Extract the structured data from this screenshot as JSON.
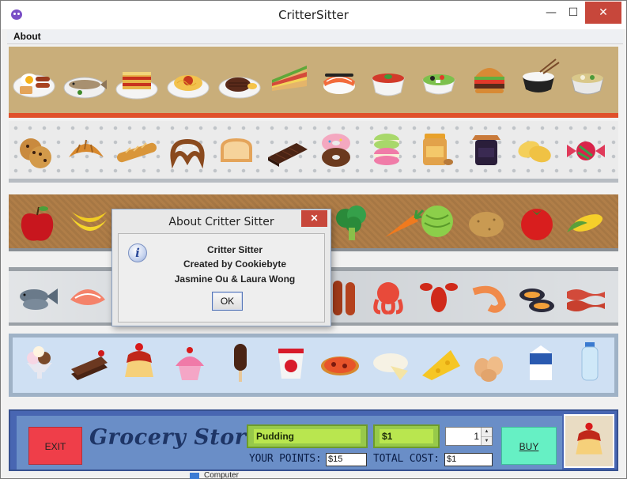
{
  "window": {
    "title": "CritterSitter",
    "controls": {
      "minimize": "—",
      "maximize": "☐",
      "close": "✕"
    }
  },
  "menubar": {
    "items": [
      "About"
    ]
  },
  "shelves": {
    "breakfast_meals": [
      "breakfast-plate-icon",
      "fish-plate-icon",
      "lasagna-icon",
      "spaghetti-icon",
      "steak-plate-icon",
      "sandwich-icon",
      "sushi-icon",
      "tomato-soup-icon",
      "salad-icon",
      "burger-icon",
      "rice-bowl-icon",
      "noodle-soup-icon"
    ],
    "snacks": [
      "cookies-icon",
      "croissant-icon",
      "baguette-icon",
      "pretzel-icon",
      "toast-icon",
      "chocolate-bar-icon",
      "donuts-icon",
      "macarons-icon",
      "peanut-butter-icon",
      "jam-jar-icon",
      "chips-icon",
      "candy-icon"
    ],
    "produce": [
      "apple-icon",
      "bananas-icon",
      "broccoli-icon",
      "carrot-icon",
      "lettuce-icon",
      "potato-icon",
      "tomato-icon",
      "corn-icon"
    ],
    "meat_seafood": [
      "fish-icon",
      "salmon-steak-icon",
      "sausages-icon",
      "octopus-icon",
      "lobster-icon",
      "shrimp-icon",
      "mussels-icon",
      "bacon-icon"
    ],
    "desserts_dairy": [
      "ice-cream-sundae-icon",
      "cake-slice-icon",
      "pudding-icon",
      "cupcake-icon",
      "ice-cream-bar-icon",
      "yogurt-icon",
      "pizza-icon",
      "brie-cheese-icon",
      "cheese-wedge-icon",
      "eggs-icon",
      "milk-carton-icon",
      "water-bottle-icon"
    ]
  },
  "store": {
    "exit_label": "EXIT",
    "title": "Grocery Store",
    "selected_item": "Pudding",
    "price": "$1",
    "quantity": "1",
    "buy_label": "BUY",
    "points_label": "YOUR POINTS:",
    "points_value": "$15",
    "cost_label": "TOTAL COST:",
    "cost_value": "$1",
    "preview_icon": "pudding-icon"
  },
  "dialog": {
    "title": "About Critter Sitter",
    "close": "✕",
    "lines": [
      "Critter Sitter",
      "Created by Cookiebyte",
      "Jasmine Ou & Laura Wong"
    ],
    "ok_label": "OK",
    "icon": "info-icon"
  },
  "taskbar": {
    "label": "Computer"
  },
  "colors": {
    "exit": "#ef3e49",
    "buy": "#66f0c4",
    "field": "#b9e64f",
    "store_bg": "#4866b2",
    "close": "#c7473b"
  }
}
